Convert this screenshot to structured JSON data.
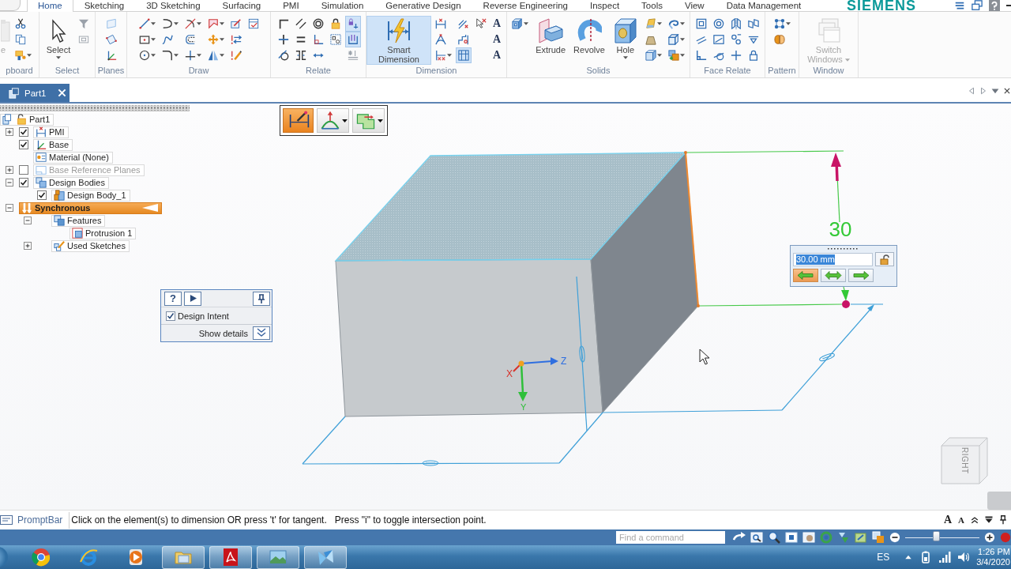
{
  "menu_tabs": [
    {
      "label": "Home",
      "selected": true
    },
    {
      "label": "Sketching",
      "selected": false
    },
    {
      "label": "3D Sketching",
      "selected": false
    },
    {
      "label": "Surfacing",
      "selected": false
    },
    {
      "label": "PMI",
      "selected": false
    },
    {
      "label": "Simulation",
      "selected": false
    },
    {
      "label": "Generative Design",
      "selected": false
    },
    {
      "label": "Reverse Engineering",
      "selected": false
    },
    {
      "label": "Inspect",
      "selected": false
    },
    {
      "label": "Tools",
      "selected": false
    },
    {
      "label": "View",
      "selected": false
    },
    {
      "label": "Data Management",
      "selected": false
    }
  ],
  "brand": "SIEMENS",
  "ribbon_groups": [
    {
      "label": "pboard",
      "buttons": [
        {
          "label": "e",
          "selected": false,
          "disabled": true
        }
      ],
      "tools": [
        {
          "on": false
        },
        {
          "on": false
        },
        {
          "on": false
        }
      ]
    },
    {
      "label": "Select",
      "buttons": [
        {
          "label": "Select",
          "selected": false,
          "disabled": false
        }
      ],
      "tools": [
        {
          "on": false
        },
        {
          "on": false
        }
      ]
    },
    {
      "label": "Planes",
      "tools": [
        {
          "on": false
        },
        {
          "on": false
        },
        {
          "on": false
        }
      ]
    },
    {
      "label": "Draw",
      "tools": [
        {
          "on": false
        },
        {
          "on": false
        },
        {
          "on": false
        },
        {
          "on": false
        },
        {
          "on": false
        },
        {
          "on": false
        },
        {
          "on": false
        },
        {
          "on": false
        },
        {
          "on": false
        },
        {
          "on": false
        },
        {
          "on": false
        },
        {
          "on": false
        },
        {
          "on": false
        },
        {
          "on": false
        },
        {
          "on": false
        },
        {
          "on": false
        }
      ]
    },
    {
      "label": "Relate",
      "tools": [
        {
          "on": false
        },
        {
          "on": false
        },
        {
          "on": false
        },
        {
          "on": false
        },
        {
          "on": false
        },
        {
          "on": false
        },
        {
          "on": false
        },
        {
          "on": false
        },
        {
          "on": false
        },
        {
          "on": false
        },
        {
          "on": false
        },
        {
          "on": true
        },
        {
          "on": true
        },
        {
          "on": false
        }
      ]
    },
    {
      "label": "Dimension",
      "buttons": [
        {
          "label": "Smart Dimension",
          "selected": true,
          "disabled": false
        }
      ],
      "tools": [
        {
          "on": false
        },
        {
          "on": false
        },
        {
          "on": false
        },
        {
          "on": false
        },
        {
          "on": false
        },
        {
          "on": true
        },
        {
          "on": false
        },
        {
          "on": false,
          "glyph": "A"
        },
        {
          "on": false,
          "glyph": "A"
        },
        {
          "on": false,
          "glyph": "A"
        }
      ]
    },
    {
      "label": "Solids",
      "buttons": [
        {
          "label": "Extrude",
          "selected": false,
          "disabled": false
        },
        {
          "label": "Revolve",
          "selected": false,
          "disabled": false
        },
        {
          "label": "Hole",
          "selected": false,
          "disabled": false
        }
      ],
      "tools": [
        {
          "on": false
        },
        {
          "on": false
        },
        {
          "on": false
        },
        {
          "on": false
        },
        {
          "on": false
        },
        {
          "on": false
        },
        {
          "on": false
        }
      ]
    },
    {
      "label": "Face Relate",
      "tools": [
        {
          "on": false
        },
        {
          "on": false
        },
        {
          "on": false
        },
        {
          "on": false
        },
        {
          "on": false
        },
        {
          "on": false
        },
        {
          "on": false
        },
        {
          "on": false
        },
        {
          "on": false
        },
        {
          "on": false
        },
        {
          "on": false
        },
        {
          "on": false
        }
      ]
    },
    {
      "label": "Pattern",
      "tools": [
        {
          "on": false
        },
        {
          "on": false
        }
      ]
    },
    {
      "label": "Window",
      "buttons": [
        {
          "label": "Switch Windows",
          "selected": false,
          "disabled": true
        }
      ]
    }
  ],
  "document_tabs": [
    {
      "label": "Part1",
      "selected": true
    }
  ],
  "pathfinder": {
    "tree": [
      {
        "label": "Part1",
        "kind": "part",
        "selected": false,
        "children": [
          {
            "label": "PMI",
            "kind": "pmi",
            "expanded": false,
            "checked": true,
            "selected": false
          },
          {
            "label": "Base",
            "kind": "coordinate_system",
            "checked": true,
            "selected": false
          },
          {
            "label": "Material (None)",
            "kind": "material",
            "selected": false
          },
          {
            "label": "Base Reference Planes",
            "kind": "planes",
            "expanded": false,
            "checked": false,
            "selected": false
          },
          {
            "label": "Design Bodies",
            "kind": "bodies",
            "expanded": true,
            "checked": true,
            "selected": false,
            "children": [
              {
                "label": "Design Body_1",
                "kind": "body",
                "checked": true,
                "selected": false
              }
            ]
          },
          {
            "label": "Synchronous",
            "kind": "environment",
            "expanded": true,
            "selected": true,
            "children": [
              {
                "label": "Features",
                "kind": "features",
                "expanded": true,
                "selected": false,
                "children": [
                  {
                    "label": "Protrusion 1",
                    "kind": "feature",
                    "selected": false
                  }
                ]
              },
              {
                "label": "Used Sketches",
                "kind": "sketches",
                "expanded": false,
                "selected": false
              }
            ]
          }
        ]
      }
    ]
  },
  "command_bar": {
    "buttons": [
      {
        "selected": true,
        "menu": false
      },
      {
        "selected": false,
        "menu": true
      },
      {
        "selected": false,
        "menu": true
      }
    ]
  },
  "design_intent": {
    "help_button": "?",
    "checkbox": {
      "label": "Design Intent",
      "checked": true
    },
    "details_button": "Show details"
  },
  "model_view": {
    "dimension_text": "30",
    "axis_labels": {
      "x": "X",
      "y": "Y",
      "z": "Z"
    },
    "view_cube_label": "RIGHT"
  },
  "dimension_editor": {
    "value": "30.00 mm",
    "locked": false,
    "direction_buttons": [
      {
        "selected": true
      },
      {
        "selected": false
      },
      {
        "selected": false
      }
    ]
  },
  "prompt_bar": {
    "title": "PromptBar",
    "message": "Click on the element(s) to dimension OR press 't' for tangent.   Press \"i\" to toggle intersection point.",
    "font_buttons": [
      "A",
      "A"
    ]
  },
  "status_bar": {
    "command_search": {
      "placeholder": "Find a command"
    },
    "zoom_slider": {
      "level": 0.41
    }
  },
  "taskbar": {
    "apps": [
      {
        "kind": "round_browser",
        "running": false
      },
      {
        "kind": "e_browser",
        "running": false
      },
      {
        "kind": "media_player",
        "running": false
      },
      {
        "kind": "folder",
        "running": true
      },
      {
        "kind": "pdf",
        "running": true
      },
      {
        "kind": "photos",
        "running": true
      },
      {
        "kind": "bird_app",
        "running": true
      }
    ],
    "language": "ES",
    "time": "1:26 PM",
    "date": "3/4/2020"
  }
}
